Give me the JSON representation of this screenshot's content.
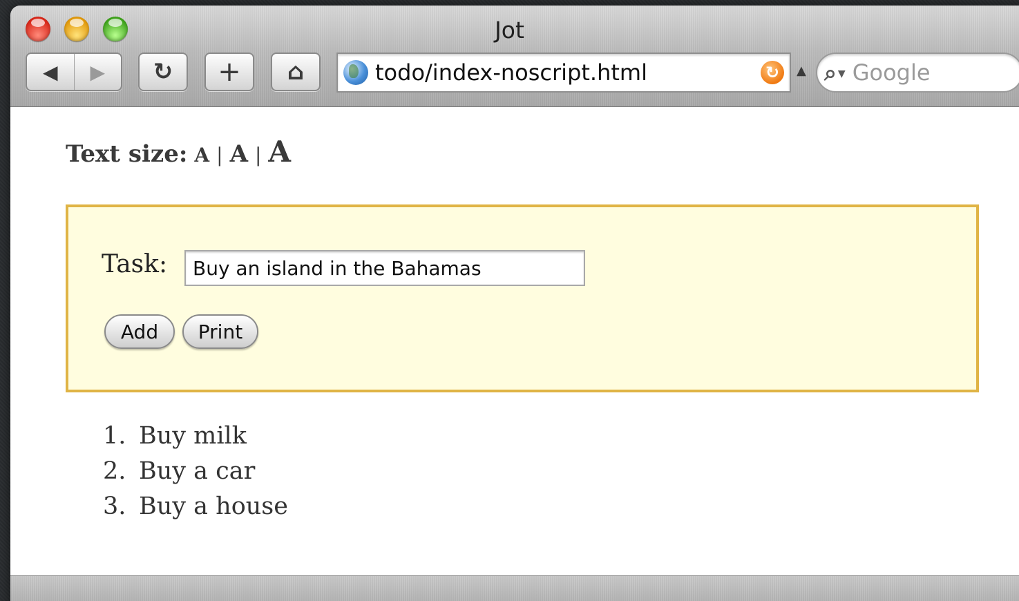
{
  "window": {
    "title": "Jot"
  },
  "toolbar": {
    "back_icon": "◀",
    "forward_icon": "▶",
    "reload_icon": "↻",
    "add_icon": "+",
    "home_icon": "⌂",
    "url": "todo/index-noscript.html",
    "rss_icon": "↻",
    "search_placeholder": "Google"
  },
  "page": {
    "text_size_label": "Text size:",
    "text_size_small": "A",
    "text_size_medium": "A",
    "text_size_large": "A",
    "separator": "|",
    "task_label": "Task:",
    "task_value": "Buy an island in the Bahamas",
    "add_button": "Add",
    "print_button": "Print",
    "todos": [
      {
        "num": "1.",
        "text": "Buy milk"
      },
      {
        "num": "2.",
        "text": "Buy a car"
      },
      {
        "num": "3.",
        "text": "Buy a house"
      }
    ]
  },
  "colors": {
    "panel_background": "#fffddf",
    "panel_border": "#e0b445"
  }
}
